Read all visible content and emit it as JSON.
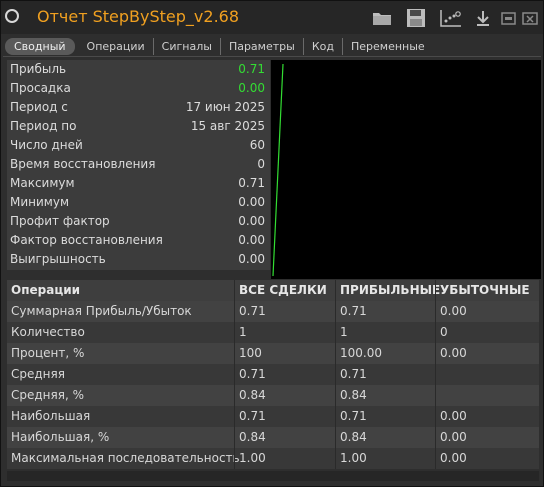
{
  "window": {
    "title": "Отчет StepByStep_v2.68"
  },
  "toolbar": {
    "icons": [
      "folder-icon",
      "save-icon",
      "chart-settings-icon",
      "download-icon",
      "minimize-icon",
      "close-icon"
    ]
  },
  "tabs": [
    {
      "label": "Сводный",
      "active": true
    },
    {
      "label": "Операции",
      "active": false
    },
    {
      "label": "Сигналы",
      "active": false
    },
    {
      "label": "Параметры",
      "active": false
    },
    {
      "label": "Код",
      "active": false
    },
    {
      "label": "Переменные",
      "active": false
    }
  ],
  "stats": [
    {
      "label": "Прибыль",
      "value": "0.71",
      "color": "#33dd33"
    },
    {
      "label": "Просадка",
      "value": "0.00",
      "color": "#33dd33"
    },
    {
      "label": "Период с",
      "value": "17 июн 2025"
    },
    {
      "label": "Период по",
      "value": "15 авг 2025"
    },
    {
      "label": "Число дней",
      "value": "60"
    },
    {
      "label": "Время восстановления",
      "value": "0"
    },
    {
      "label": "Максимум",
      "value": "0.71"
    },
    {
      "label": "Минимум",
      "value": "0.00"
    },
    {
      "label": "Профит фактор",
      "value": "0.00"
    },
    {
      "label": "Фактор восстановления",
      "value": "0.00"
    },
    {
      "label": "Выигрышность",
      "value": "0.00"
    }
  ],
  "operations": {
    "headers": [
      "Операции",
      "ВСЕ СДЕЛКИ",
      "ПРИБЫЛЬНЫЕ",
      "УБЫТОЧНЫЕ"
    ],
    "rows": [
      [
        "Суммарная Прибыль/Убыток",
        "0.71",
        "0.71",
        "0.00"
      ],
      [
        "Количество",
        "1",
        "1",
        "0"
      ],
      [
        "Процент, %",
        "100",
        "100.00",
        "0.00"
      ],
      [
        "Средняя",
        "0.71",
        "0.71",
        ""
      ],
      [
        "Средняя, %",
        "0.84",
        "0.84",
        ""
      ],
      [
        "Наибольшая",
        "0.71",
        "0.71",
        "0.00"
      ],
      [
        "Наибольшая, %",
        "0.84",
        "0.84",
        "0.00"
      ],
      [
        "Максимальная последовательность",
        "1.00",
        "1.00",
        "0.00"
      ]
    ]
  },
  "chart_data": {
    "type": "line",
    "series": [
      {
        "values": [
          0.0,
          0.71
        ],
        "color": "#33dd33"
      }
    ]
  }
}
